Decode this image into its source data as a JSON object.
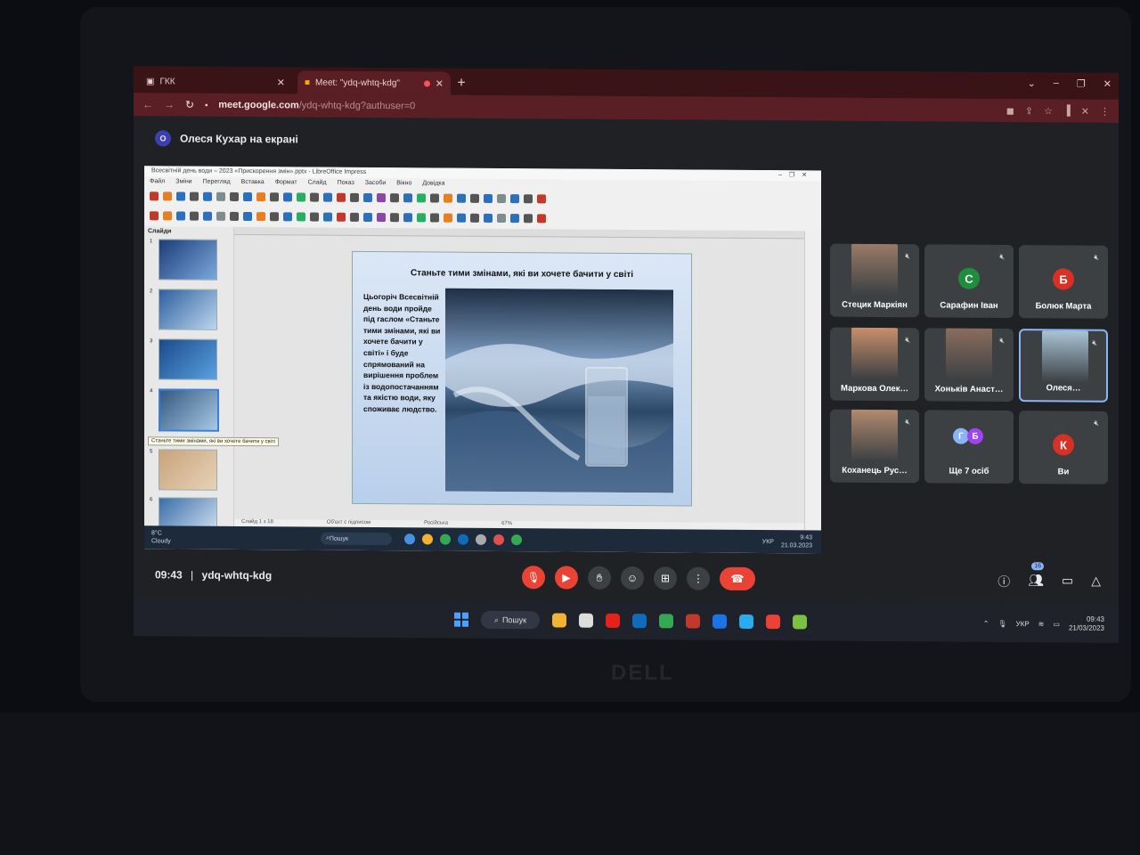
{
  "browser": {
    "tabs": [
      {
        "title": "ГКК",
        "active": false
      },
      {
        "title": "Meet: \"ydq-whtq-kdg\"",
        "active": true
      }
    ],
    "url_host": "meet.google.com",
    "url_path": "/ydq-whtq-kdg?authuser=0"
  },
  "meet": {
    "presenting_initial": "О",
    "presenting_label": "Олеся Кухар на екрані",
    "time": "09:43",
    "separator": "|",
    "meeting_code": "ydq-whtq-kdg",
    "participant_count": "16",
    "tiles": [
      {
        "name": "Стецик Маркіян",
        "type": "video",
        "color": "#9a7b66"
      },
      {
        "name": "Сарафин Іван",
        "type": "letter",
        "letter": "С",
        "color": "#1e8e3e"
      },
      {
        "name": "Болюк Марта",
        "type": "letter",
        "letter": "Б",
        "color": "#d93025"
      },
      {
        "name": "Маркова Олек…",
        "type": "video",
        "color": "#c98f6a"
      },
      {
        "name": "Хоньків Анаст…",
        "type": "video",
        "color": "#8a6d5c"
      },
      {
        "name": "Олеся…",
        "type": "video",
        "color": "#a9c4d6",
        "pinned": true
      },
      {
        "name": "Коханець Рус…",
        "type": "video",
        "color": "#b38a70"
      },
      {
        "name": "Ще 7 осіб",
        "type": "more",
        "letters": [
          "Г",
          "Б"
        ]
      },
      {
        "name": "Ви",
        "type": "letter",
        "letter": "К",
        "color": "#d93025"
      }
    ]
  },
  "impress": {
    "window_title": "Всесвітній день води – 2023 «Прискорення змін».pptx - LibreOffice Impress",
    "menu": [
      "Файл",
      "Зміни",
      "Перегляд",
      "Вставка",
      "Формат",
      "Слайд",
      "Показ",
      "Засоби",
      "Вікно",
      "Довідка"
    ],
    "slides_pane_title": "Слайди",
    "tooltip": "Станьте тими змінами, які ви хочете бачити у світі",
    "slide_title": "Станьте тими змінами, які ви хочете бачити у світі",
    "slide_text": "Цьогоріч Всесвітній день води пройде під гаслом «Станьте тими змінами, які ви хочете бачити у світі» і буде спрямований на вирішення проблем із водопостачанням та якістю води, яку споживає людство.",
    "status_slide": "Слайд 1 з 18",
    "status_object": "Об'єкт с підписом",
    "status_language": "Російська",
    "status_zoom": "67%"
  },
  "inner_taskbar": {
    "weather_temp": "8°C",
    "weather_desc": "Cloudy",
    "search": "Пошук",
    "lang": "УКР",
    "time": "9:43",
    "date": "21.03.2023"
  },
  "os_taskbar": {
    "search": "Пошук",
    "lang": "УКР",
    "time": "09:43",
    "date": "21/03/2023"
  },
  "laptop_brand": "DELL"
}
